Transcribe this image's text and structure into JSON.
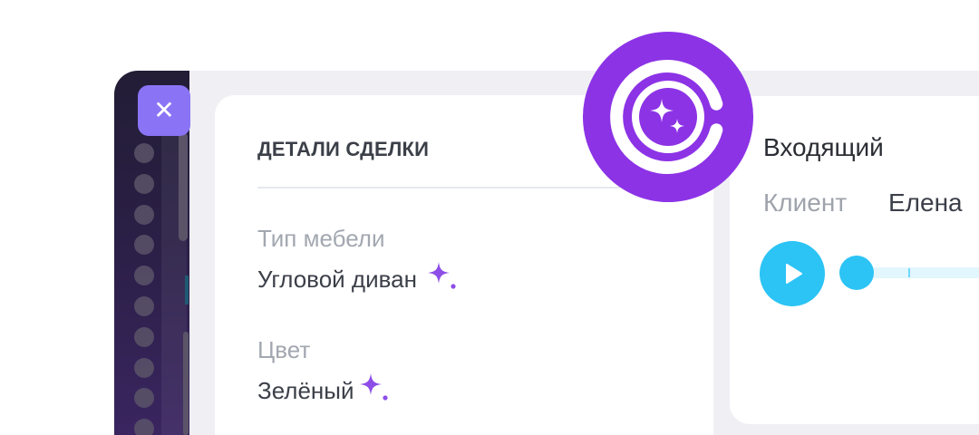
{
  "sidebar": {
    "close_glyph": "✕",
    "item_count": 10
  },
  "deal_details": {
    "title": "ДЕТАЛИ СДЕЛКИ",
    "fields": [
      {
        "label": "Тип мебели",
        "value": "Угловой диван",
        "ai_filled": true
      },
      {
        "label": "Цвет",
        "value": "Зелёный",
        "ai_filled": true
      }
    ]
  },
  "call": {
    "title": "Входящий",
    "client_label": "Клиент",
    "client_name": "Елена"
  },
  "colors": {
    "brand_purple": "#8c33e6",
    "accent_purple": "#8a74f5",
    "player_blue": "#2cc3f5",
    "text_dark": "#3b3f48",
    "text_muted": "#a2a7b0"
  },
  "icons": {
    "close": "close-icon",
    "sparkle": "sparkle-icon",
    "play": "play-icon",
    "logo": "ai-logo-icon"
  }
}
